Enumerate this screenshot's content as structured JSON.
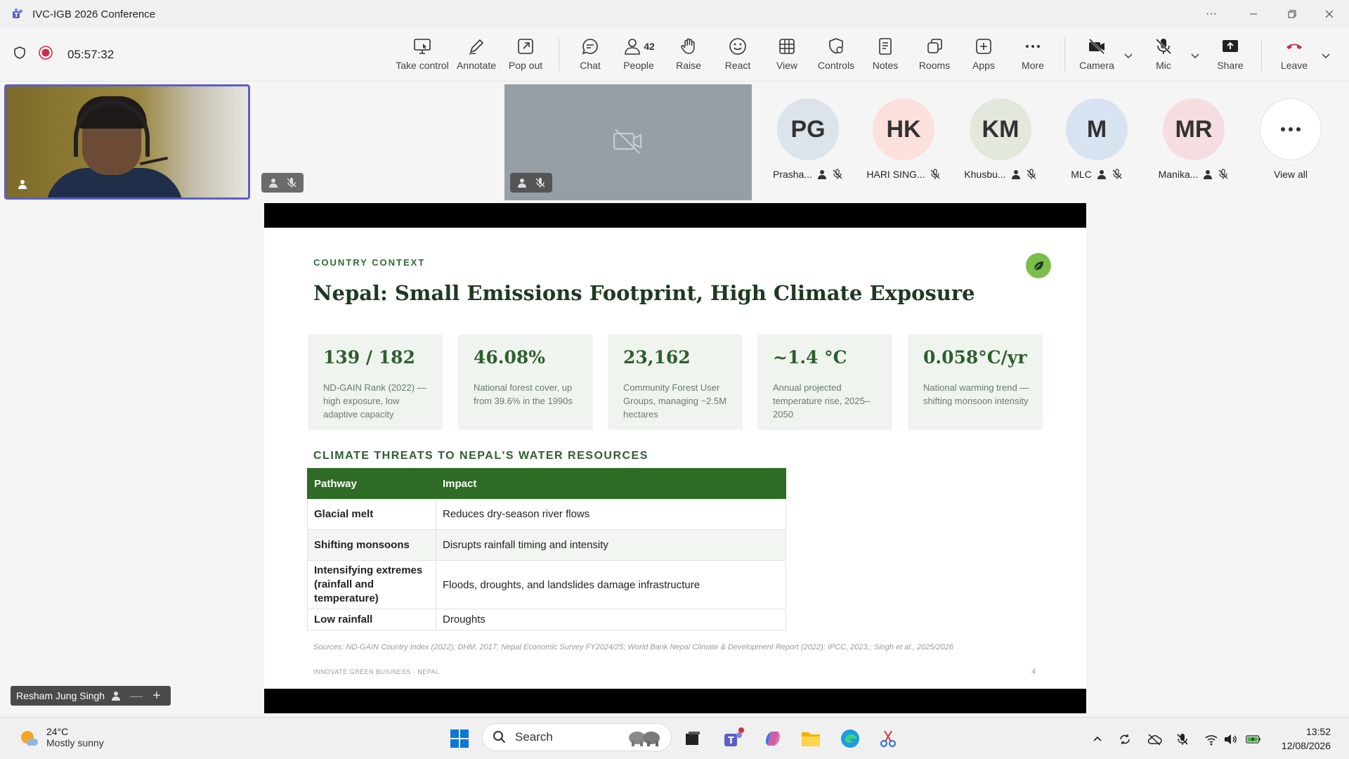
{
  "window": {
    "title": "IVC-IGB 2026 Conference"
  },
  "meeting": {
    "timer": "05:57:32"
  },
  "toolbar": {
    "take_control": "Take control",
    "annotate": "Annotate",
    "pop_out": "Pop out",
    "chat": "Chat",
    "people": "People",
    "people_count": "42",
    "raise": "Raise",
    "react": "React",
    "view": "View",
    "controls": "Controls",
    "notes": "Notes",
    "rooms": "Rooms",
    "apps": "Apps",
    "more": "More",
    "camera": "Camera",
    "mic": "Mic",
    "share": "Share",
    "leave": "Leave"
  },
  "participants": [
    {
      "initials": "PG",
      "name": "Prasha...",
      "color": "#dce3ea"
    },
    {
      "initials": "HK",
      "name": "HARI SING...",
      "color": "#fbe0dc"
    },
    {
      "initials": "KM",
      "name": "Khusbu...",
      "color": "#e3e8dc"
    },
    {
      "initials": "M",
      "name": "MLC",
      "color": "#d8e3f2"
    },
    {
      "initials": "MR",
      "name": "Manika...",
      "color": "#f6dde0"
    }
  ],
  "view_all": "View all",
  "presenter": {
    "name": "Resham Jung Singh"
  },
  "slide": {
    "eyebrow": "COUNTRY CONTEXT",
    "title": "Nepal: Small Emissions Footprint, High Climate Exposure",
    "stats": [
      {
        "value": "139 / 182",
        "desc": "ND-GAIN Rank (2022) — high exposure, low adaptive capacity"
      },
      {
        "value": "46.08%",
        "desc": "National forest cover, up from 39.6% in the 1990s"
      },
      {
        "value": "23,162",
        "desc": "Community Forest User Groups, managing ~2.5M hectares"
      },
      {
        "value": "~1.4 °C",
        "desc": "Annual projected temperature rise, 2025–2050"
      },
      {
        "value": "0.058°C/yr",
        "desc": "National warming trend — shifting monsoon intensity"
      }
    ],
    "section_title": "CLIMATE THREATS TO NEPAL'S WATER RESOURCES",
    "table": {
      "headers": [
        "Pathway",
        "Impact"
      ],
      "rows": [
        {
          "pathway": "Glacial melt",
          "impact": "Reduces dry-season river flows"
        },
        {
          "pathway": "Shifting monsoons",
          "impact": "Disrupts rainfall timing and intensity"
        },
        {
          "pathway": "Intensifying extremes (rainfall and temperature)",
          "impact": "Floods, droughts, and landslides damage infrastructure"
        },
        {
          "pathway": "Low rainfall",
          "impact": "Droughts"
        }
      ]
    },
    "sources": "Sources: ND-GAIN Country Index (2022); DHM, 2017; Nepal Economic Survey FY2024/25; World Bank Nepal Climate & Development Report (2022); IPCC, 2023.; Singh et al., 2025/2026",
    "footer_left": "INNOVATE GREEN BUSINESS · NEPAL",
    "page_number": "4"
  },
  "taskbar": {
    "weather_temp": "24°C",
    "weather_cond": "Mostly sunny",
    "search_placeholder": "Search",
    "time": "13:52",
    "date": "12/08/2026"
  }
}
